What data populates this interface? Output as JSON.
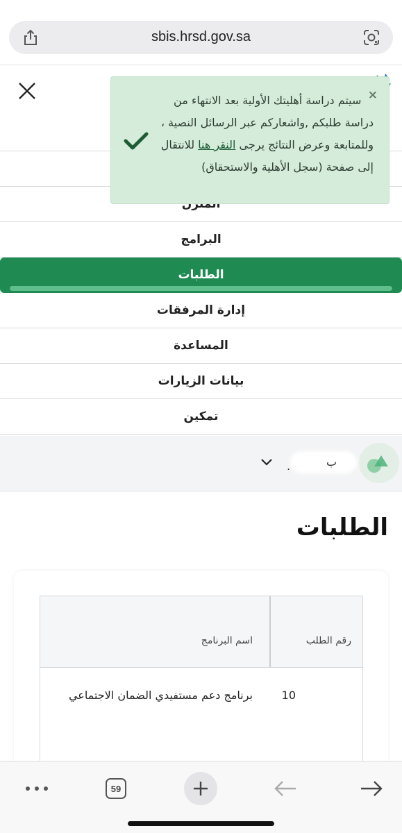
{
  "browser": {
    "url": "sbis.hrsd.gov.sa",
    "tabs_count": "59"
  },
  "nav": {
    "items": [
      {
        "label": "المنزل"
      },
      {
        "label": "البرامج"
      },
      {
        "label": "الطلبات"
      },
      {
        "label": "إدارة المرفقات"
      },
      {
        "label": "المساعدة"
      },
      {
        "label": "بيانات الزيارات"
      },
      {
        "label": "تمكين"
      }
    ],
    "active_index": 2
  },
  "toast": {
    "close_glyph": "×",
    "message_part1": "سيتم دراسة أهليتك الأولية بعد الانتهاء من دراسة طلبكم ,واشعاركم عبر الرسائل النصية ، وللمتابعة وعرض النتائج يرجى",
    "link_text": "النقر هنا",
    "message_part2": "للانتقال إلى صفحة (سجل الأهلية والاستحقاق)"
  },
  "user": {
    "name_fragment": "ب",
    "dot": "."
  },
  "page": {
    "title": "الطلبات"
  },
  "table": {
    "headers": [
      "رقم الطلب",
      "اسم البرنامج"
    ],
    "rows": [
      {
        "request_number": "10",
        "program_name": "برنامج دعم مستفيدي الضمان الاجتماعي"
      }
    ]
  },
  "colors": {
    "accent_green": "#1f8a52",
    "toast_bg": "#d4ecd9"
  }
}
